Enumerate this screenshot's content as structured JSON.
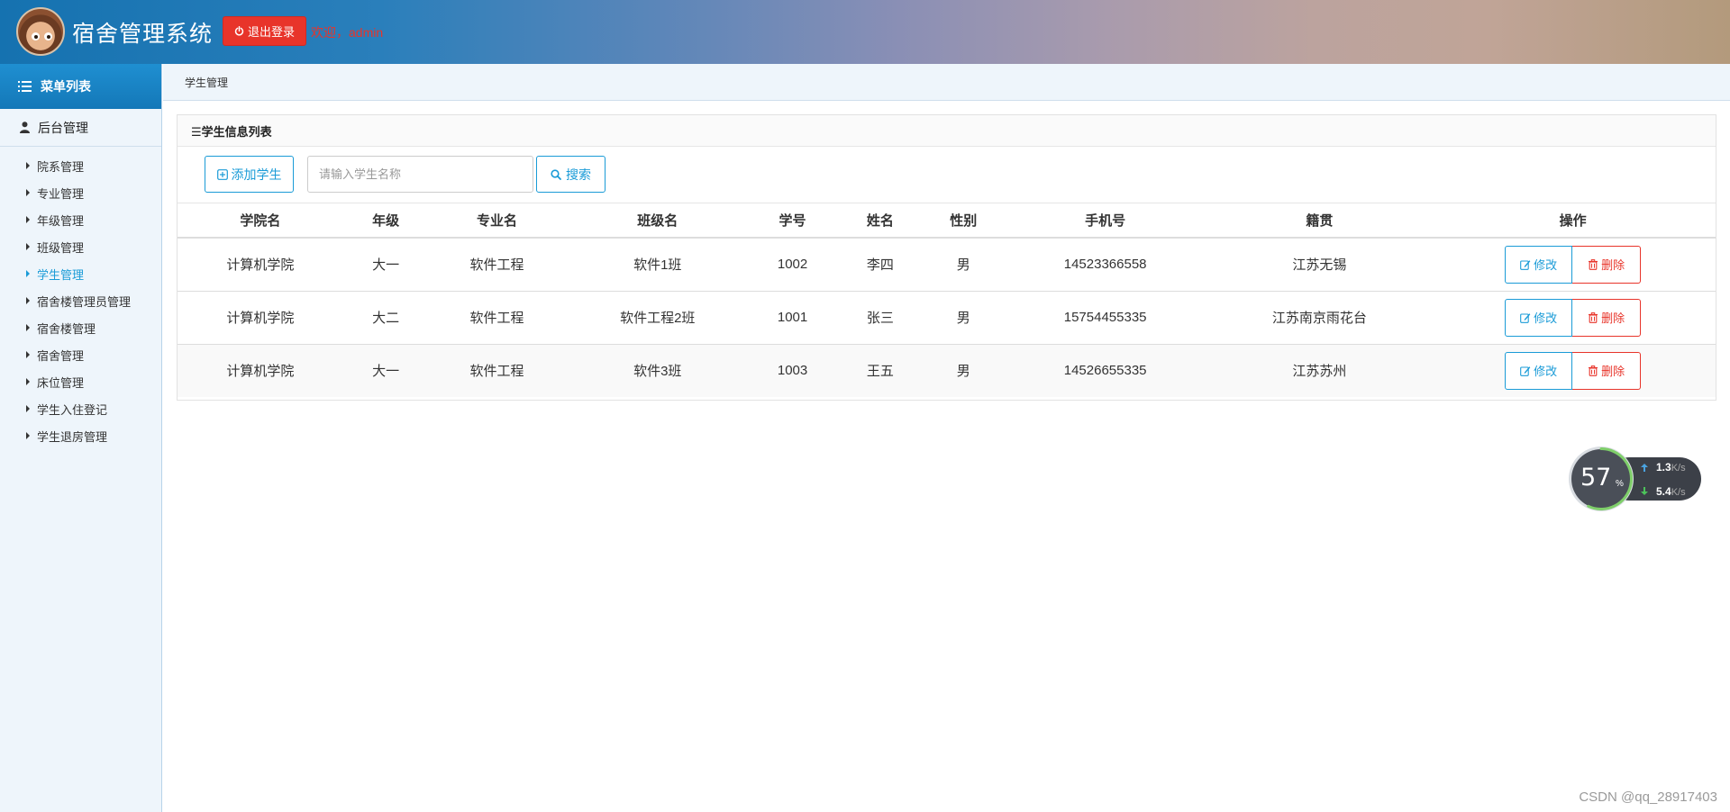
{
  "header": {
    "app_title": "宿舍管理系统",
    "logout_label": "退出登录",
    "welcome_text": "欢迎，admin"
  },
  "sidebar": {
    "menu_title": "菜单列表",
    "group_title": "后台管理",
    "items": [
      {
        "label": "院系管理",
        "active": false
      },
      {
        "label": "专业管理",
        "active": false
      },
      {
        "label": "年级管理",
        "active": false
      },
      {
        "label": "班级管理",
        "active": false
      },
      {
        "label": "学生管理",
        "active": true
      },
      {
        "label": "宿舍楼管理员管理",
        "active": false
      },
      {
        "label": "宿舍楼管理",
        "active": false
      },
      {
        "label": "宿舍管理",
        "active": false
      },
      {
        "label": "床位管理",
        "active": false
      },
      {
        "label": "学生入住登记",
        "active": false
      },
      {
        "label": "学生退房管理",
        "active": false
      }
    ]
  },
  "breadcrumb": "学生管理",
  "panel": {
    "title": "☰学生信息列表",
    "add_label": "添加学生",
    "search_placeholder": "请输入学生名称",
    "search_value": "",
    "search_label": "搜索"
  },
  "table": {
    "columns": [
      "学院名",
      "年级",
      "专业名",
      "班级名",
      "学号",
      "姓名",
      "性别",
      "手机号",
      "籍贯",
      "操作"
    ],
    "edit_label": "修改",
    "delete_label": "删除",
    "rows": [
      [
        "计算机学院",
        "大一",
        "软件工程",
        "软件1班",
        "1002",
        "李四",
        "男",
        "14523366558",
        "江苏无锡"
      ],
      [
        "计算机学院",
        "大二",
        "软件工程",
        "软件工程2班",
        "1001",
        "张三",
        "男",
        "15754455335",
        "江苏南京雨花台"
      ],
      [
        "计算机学院",
        "大一",
        "软件工程",
        "软件3班",
        "1003",
        "王五",
        "男",
        "14526655335",
        "江苏苏州"
      ]
    ]
  },
  "net_widget": {
    "percent": "57",
    "percent_sign": "%",
    "up_value": "1.3",
    "down_value": "5.4",
    "unit": "K/s"
  },
  "watermark": "CSDN @qq_28917403",
  "colors": {
    "primary": "#1a9bd7",
    "danger": "#e8342a",
    "sidebar_bg": "#eef5fb"
  }
}
